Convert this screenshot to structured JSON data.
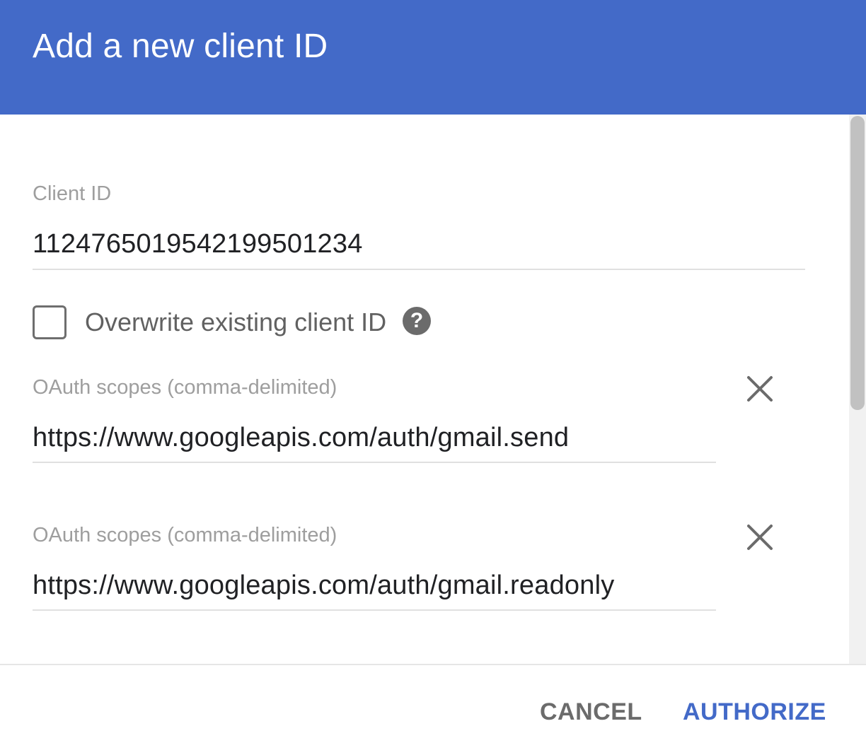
{
  "dialog": {
    "title": "Add a new client ID"
  },
  "client_id": {
    "label": "Client ID",
    "value": "112476501954219950 1234"
  },
  "overwrite": {
    "label": "Overwrite existing client ID",
    "checked": false,
    "help_icon": "help-circle-icon",
    "help_glyph": "?"
  },
  "scopes": [
    {
      "label": "OAuth scopes (comma-delimited)",
      "value": "https://www.googleapis.com/auth/gmail.send",
      "remove_icon": "close-icon"
    },
    {
      "label": "OAuth scopes (comma-delimited)",
      "value": "https://www.googleapis.com/auth/gmail.readonly",
      "remove_icon": "close-icon"
    }
  ],
  "footer": {
    "cancel_label": "CANCEL",
    "authorize_label": "AUTHORIZE"
  },
  "colors": {
    "header_bg": "#436ac8",
    "accent": "#436ac8",
    "label_gray": "#9e9e9e"
  }
}
